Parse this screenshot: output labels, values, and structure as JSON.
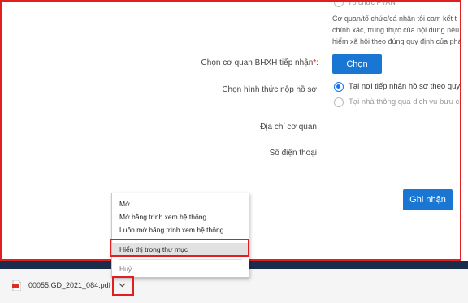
{
  "form": {
    "top_radio_label": "Tổ chức FVAN",
    "commitment_lines": [
      "Cơ quan/tổ chức/cá nhân tôi cam kết t",
      "chính xác, trung thực của nội dung nêu t",
      "hiểm xã hội theo đúng quy định của pháp"
    ],
    "agency_label": "Chọn cơ quan BHXH tiếp nhận",
    "required_mark": "*",
    "agency_colon": ":",
    "choose_button": "Chọn",
    "submit_method_label": "Chọn hình thức nộp hồ sơ",
    "method_options": [
      {
        "label": "Tại nơi tiếp nhận hồ sơ theo quy đị",
        "checked": true
      },
      {
        "label": "Tại nhà thông qua dịch vụ bưu chín",
        "checked": false
      }
    ],
    "address_label": "Địa chỉ cơ quan",
    "phone_label": "Số điện thoại",
    "save_button": "Ghi nhận"
  },
  "context_menu": {
    "items": [
      "Mở",
      "Mở bằng trình xem hệ thống",
      "Luôn mở bằng trình xem hệ thống",
      "Hiển thị trong thư mục",
      "Huỷ"
    ],
    "highlighted_index": 3
  },
  "download": {
    "file_name": "00055.GD_2021_084.pdf",
    "file_icon": "pdf-file-icon",
    "menu_icon": "chevron-down-icon"
  },
  "colors": {
    "accent": "#1976d2",
    "highlight_border": "#e02020",
    "bottom_bar": "#1c2d4c"
  }
}
